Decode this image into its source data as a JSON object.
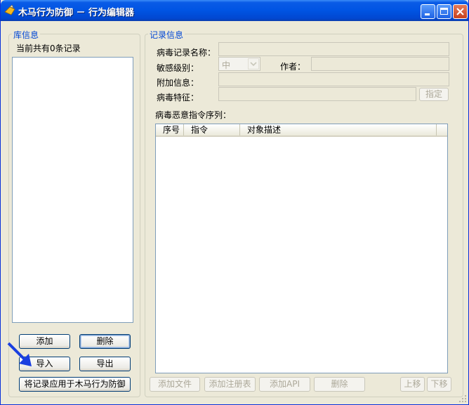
{
  "window": {
    "title": "木马行为防御 － 行为编辑器"
  },
  "library": {
    "group_label": "库信息",
    "count_text": "当前共有0条记录",
    "add_label": "添加",
    "delete_label": "删除",
    "import_label": "导入",
    "export_label": "导出",
    "apply_label": "将记录应用于木马行为防御"
  },
  "record": {
    "group_label": "记录信息",
    "name_label": "病毒记录名称：",
    "name_value": "",
    "sensitivity_label": "敏感级别：",
    "sensitivity_value": "中",
    "author_label": "作者：",
    "author_value": "",
    "extra_label": "附加信息：",
    "extra_value": "",
    "signature_label": "病毒特征：",
    "signature_value": "",
    "specify_label": "指定",
    "sequence_label": "病毒恶意指令序列：",
    "columns": [
      "序号",
      "指令",
      "对象描述"
    ],
    "add_file_label": "添加文件",
    "add_registry_label": "添加注册表",
    "add_api_label": "添加API",
    "delete_label": "删除",
    "move_up_label": "上移",
    "move_down_label": "下移"
  },
  "colors": {
    "title_bar": "#0054E3",
    "group_label": "#0046D5",
    "face": "#ECE9D8",
    "arrow": "#1A3FE0"
  }
}
